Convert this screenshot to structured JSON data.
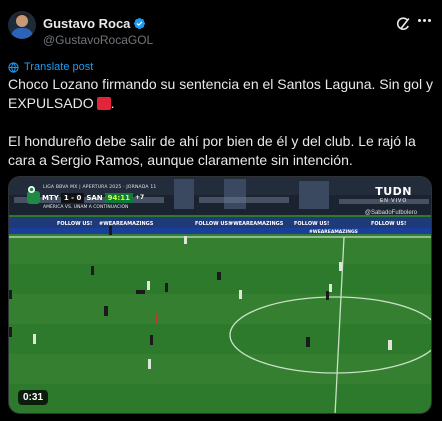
{
  "author": {
    "name": "Gustavo Roca",
    "handle": "@GustavoRocaGOL",
    "verified": true
  },
  "actions": {
    "grok_icon": "grok-icon",
    "more_icon": "more-icon"
  },
  "translate": {
    "label": "Translate post"
  },
  "post": {
    "line1": "Choco Lozano firmando su sentencia en el Santos Laguna. Sin gol y EXPULSADO",
    "line1_end": ".",
    "line2": "El hondureño debe salir de ahí por bien de él y del club. Le rajó la cara a Sergio Ramos, aunque claramente sin intención."
  },
  "video": {
    "timecode": "0:31",
    "scoreboard": {
      "league": "LIGA BBVA MX | APERTURA 2025 · JORNADA 11",
      "home": "MTY",
      "score": "1 - 0",
      "away": "SAN",
      "clock": "94:11",
      "extra": "+7",
      "subtitle": "AMÉRICA VS. UNAM A CONTINUACIÓN"
    },
    "broadcaster": "TUDN",
    "broadcaster_sub": "EN VIVO",
    "watermark": "@SabadoFutbolero"
  },
  "colors": {
    "accent": "#1d9bf0",
    "red_card": "#e3253c",
    "pitch": "#2e7a2c"
  }
}
